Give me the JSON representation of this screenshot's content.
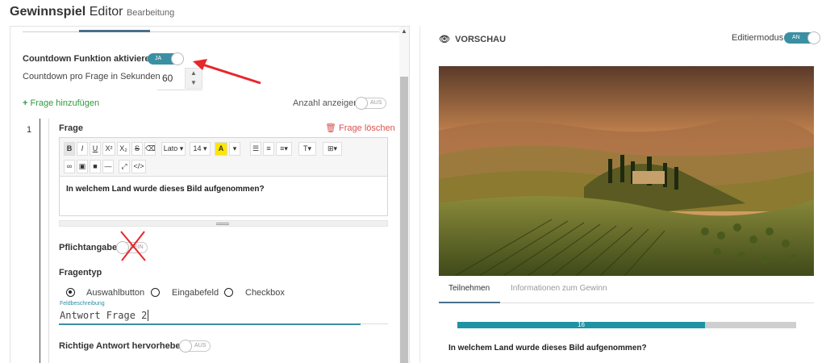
{
  "header": {
    "title_bold": "Gewinnspiel",
    "title_rest": " Editor",
    "subtitle": "Bearbeitung"
  },
  "left": {
    "countdown_label": "Countdown Funktion aktivieren",
    "countdown_toggle": "JA",
    "countdown_seconds_label": "Countdown pro Frage in Sekunden",
    "countdown_seconds_value": "60",
    "add_question": "Frage hinzufügen",
    "show_count_label": "Anzahl anzeigen",
    "show_count_toggle": "AUS",
    "question_number": "1",
    "question_heading": "Frage",
    "delete_question": "Frage löschen",
    "toolbar": {
      "font": "Lato",
      "size": "14"
    },
    "question_text": "In welchem Land wurde dieses Bild aufgenommen?",
    "required_label": "Pflichtangabe",
    "required_toggle": "NEIN",
    "type_label": "Fragentyp",
    "types": [
      "Auswahlbutton",
      "Eingabefeld",
      "Checkbox"
    ],
    "selected_type": "Auswahlbutton",
    "field_desc_label": "Feldbeschreibung",
    "field_value": "Antwort Frage 2",
    "highlight_label": "Richtige Antwort hervorheben",
    "highlight_toggle": "AUS"
  },
  "right": {
    "preview_title": "VORSCHAU",
    "edit_mode_label": "Editiermodus",
    "edit_mode_toggle": "AN",
    "tabs": [
      "Teilnehmen",
      "Informationen zum Gewinn"
    ],
    "progress_value": "16",
    "progress_fraction": 0.73,
    "question": "In welchem Land wurde dieses Bild aufgenommen?"
  },
  "colors": {
    "accent": "#3b8fa3",
    "add": "#2e9b3e",
    "delete": "#d9534f",
    "annotation": "#e8262b"
  }
}
